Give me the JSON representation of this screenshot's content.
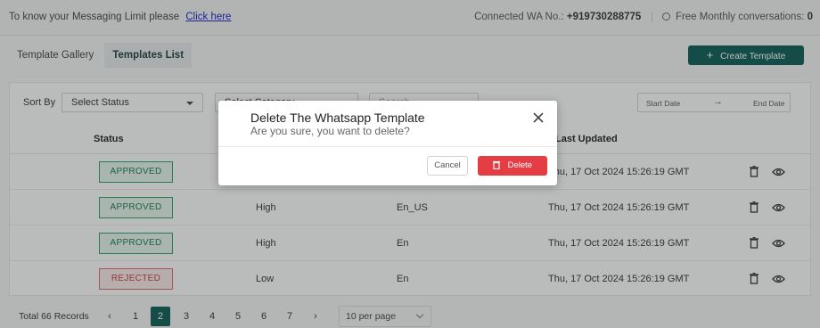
{
  "topbar": {
    "message": "To know your Messaging Limit please",
    "link": "Click here",
    "connected_label": "Connected WA No.:",
    "connected_number": "+919730288775",
    "free_label": "Free Monthly conversations:",
    "free_count": "0"
  },
  "tabs": [
    "Template Gallery",
    "Templates List"
  ],
  "create_button": "Create Template",
  "filters": {
    "sort_label": "Sort By",
    "status_select": "Select Status",
    "category_select": "Select Category",
    "search_placeholder": "Search",
    "start_date": "Start Date",
    "end_date": "End Date"
  },
  "table": {
    "headers": [
      "Status",
      "Last Updated"
    ],
    "rows": [
      {
        "status": "APPROVED",
        "priority": "",
        "language": "",
        "updated": "Thu, 17 Oct 2024 15:26:19 GMT"
      },
      {
        "status": "APPROVED",
        "priority": "High",
        "language": "En_US",
        "updated": "Thu, 17 Oct 2024 15:26:19 GMT"
      },
      {
        "status": "APPROVED",
        "priority": "High",
        "language": "En",
        "updated": "Thu, 17 Oct 2024 15:26:19 GMT"
      },
      {
        "status": "REJECTED",
        "priority": "Low",
        "language": "En",
        "updated": "Thu, 17 Oct 2024 15:26:19 GMT"
      }
    ]
  },
  "footer": {
    "total": "Total 66 Records",
    "pages": [
      "1",
      "2",
      "3",
      "4",
      "5",
      "6",
      "7"
    ],
    "current_page": "2",
    "per_page": "10 per page"
  },
  "modal": {
    "title": "Delete The Whatsapp Template",
    "subtitle": "Are you sure, you want to delete?",
    "cancel": "Cancel",
    "delete": "Delete"
  },
  "colors": {
    "primary": "#0b5c54",
    "danger": "#e43d43",
    "approved": "#1d7a4e",
    "rejected": "#c83a3a"
  }
}
